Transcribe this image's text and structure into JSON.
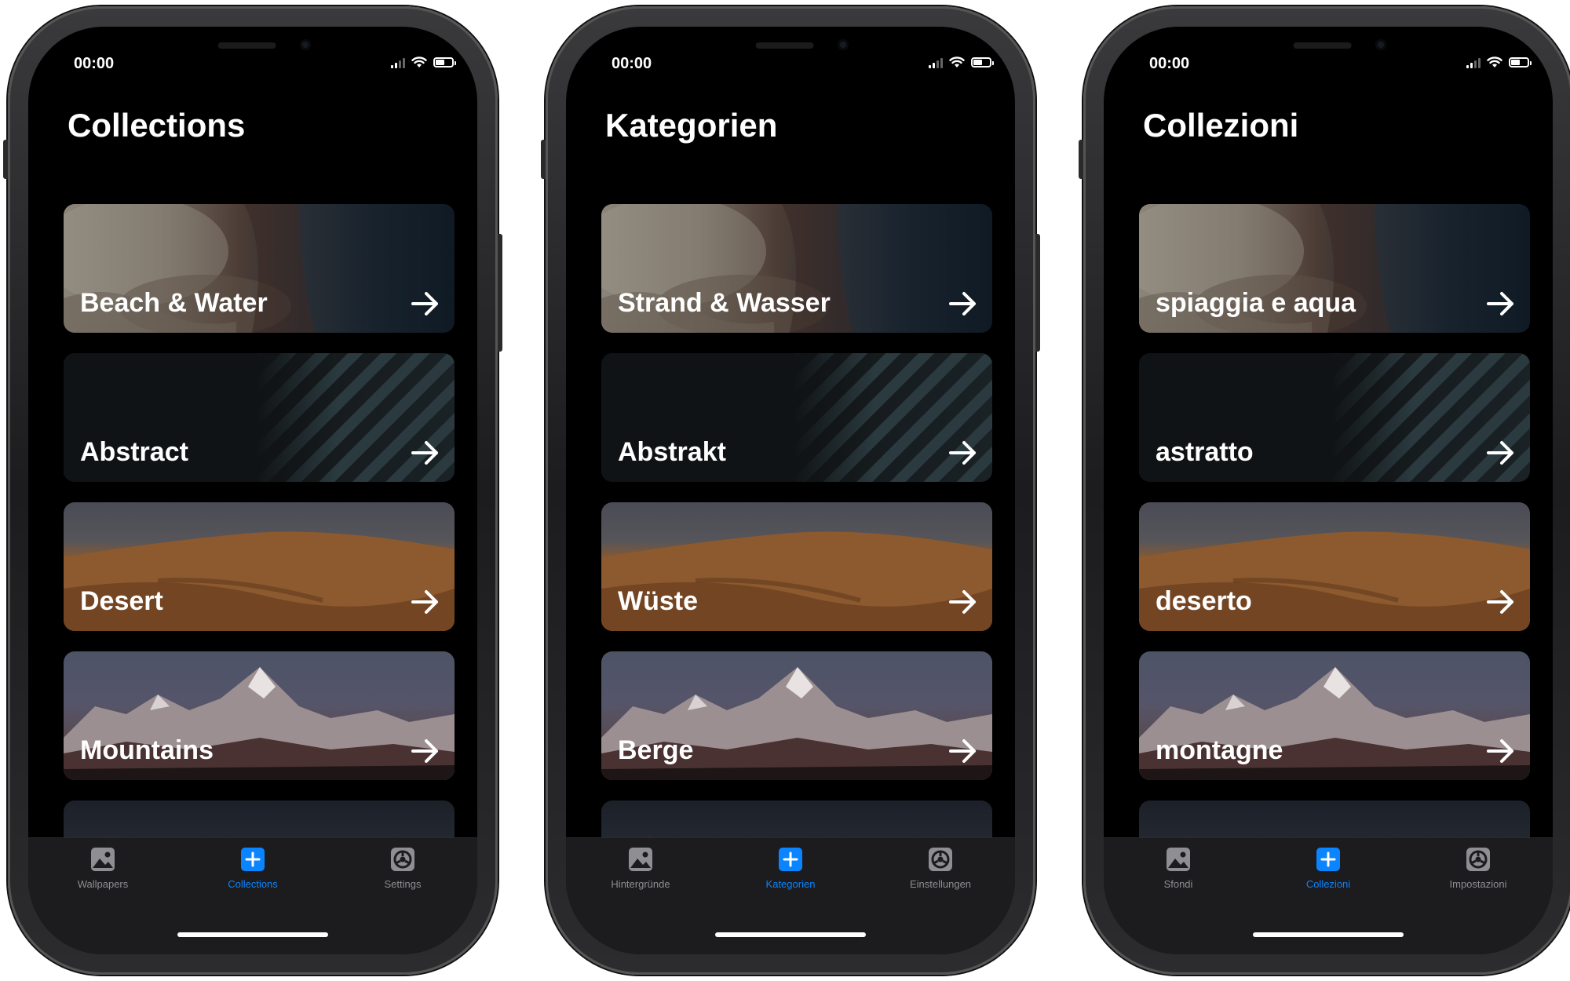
{
  "colors": {
    "accent": "#0a84ff",
    "tab_inactive": "#8e8e93",
    "tabbar_bg": "#1c1c1e",
    "screen_bg": "#000000"
  },
  "icons": {
    "tab_wallpapers": "photo-icon",
    "tab_collections": "plus-square-icon",
    "tab_settings": "gear-icon",
    "card_arrow": "arrow-right-icon"
  },
  "phones": [
    {
      "status_time": "00:00",
      "title": "Collections",
      "cards": [
        "Beach & Water",
        "Abstract",
        "Desert",
        "Mountains"
      ],
      "tabs": {
        "wallpapers": "Wallpapers",
        "collections": "Collections",
        "settings": "Settings"
      }
    },
    {
      "status_time": "00:00",
      "title": "Kategorien",
      "cards": [
        "Strand & Wasser",
        "Abstrakt",
        "Wüste",
        "Berge"
      ],
      "tabs": {
        "wallpapers": "Hintergründe",
        "collections": "Kategorien",
        "settings": "Einstellungen"
      }
    },
    {
      "status_time": "00:00",
      "title": "Collezioni",
      "cards": [
        "spiaggia e aqua",
        "astratto",
        "deserto",
        "montagne"
      ],
      "tabs": {
        "wallpapers": "Sfondi",
        "collections": "Collezioni",
        "settings": "Impostazioni"
      }
    }
  ]
}
